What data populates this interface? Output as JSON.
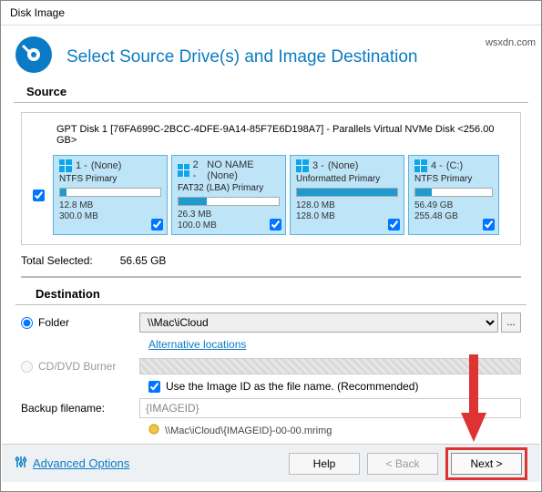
{
  "title": "Disk Image",
  "header": "Select Source Drive(s) and Image Destination",
  "section_source": "Source",
  "disk_title": "GPT Disk 1 [76FA699C-2BCC-4DFE-9A14-85F7E6D198A7] - Parallels Virtual NVMe Disk  <256.00 GB>",
  "partitions": [
    {
      "num": "1 - ",
      "name": "(None)",
      "type": "NTFS Primary",
      "used": "12.8 MB",
      "total": "300.0 MB",
      "fill_pct": 6
    },
    {
      "num": "2 - ",
      "name": "NO NAME (None)",
      "type": "FAT32 (LBA) Primary",
      "used": "26.3 MB",
      "total": "100.0 MB",
      "fill_pct": 28
    },
    {
      "num": "3 - ",
      "name": "(None)",
      "type": "Unformatted Primary",
      "used": "128.0 MB",
      "total": "128.0 MB",
      "fill_pct": 100
    },
    {
      "num": "4 - ",
      "name": "(C:)",
      "type": "NTFS Primary",
      "used": "56.49 GB",
      "total": "255.48 GB",
      "fill_pct": 22
    }
  ],
  "totals": {
    "label": "Total Selected:",
    "value": "56.65 GB"
  },
  "section_dest": "Destination",
  "folder_label": "Folder",
  "folder_value": "\\\\Mac\\iCloud",
  "alt_locations": "Alternative locations",
  "cd_label": "CD/DVD Burner",
  "use_imageid": "Use the Image ID as the file name.   (Recommended)",
  "backup_fn_label": "Backup filename:",
  "backup_fn_value": "{IMAGEID}",
  "output_path": "\\\\Mac\\iCloud\\{IMAGEID}-00-00.mrimg",
  "adv_options": "Advanced Options",
  "buttons": {
    "help": "Help",
    "back": "< Back",
    "next": "Next >"
  },
  "browse": "...",
  "watermark": "wsxdn.com"
}
